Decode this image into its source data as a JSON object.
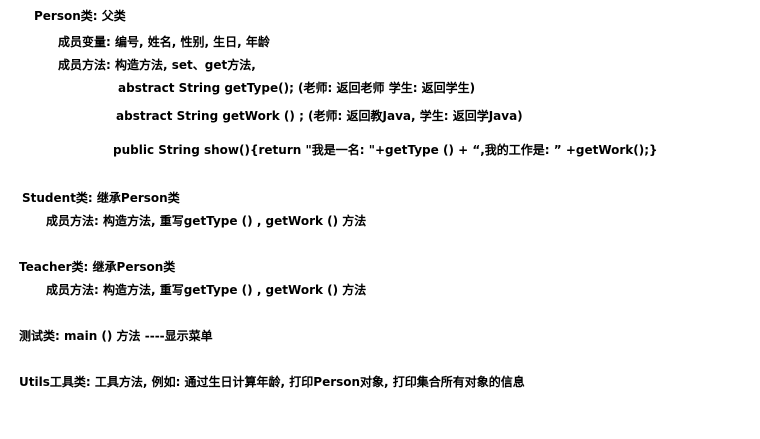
{
  "document": {
    "person": {
      "heading": "Person类: 父类",
      "fields": "成员变量: 编号, 姓名, 性别, 生日, 年龄",
      "methods": "成员方法:  构造方法, set、get方法,",
      "get_type": "abstract String getType(); (老师:  返回老师  学生:  返回学生)",
      "get_work": "abstract  String getWork  ()  ;   (老师:  返回教Java, 学生: 返回学Java)",
      "show": "public String show(){return \"我是一名: \"+getType  ()  + “,我的工作是: ”  +getWork();}"
    },
    "student": {
      "heading": "Student类:  继承Person类",
      "methods": "成员方法:  构造方法, 重写getType  ()  ,  getWork  ()  方法"
    },
    "teacher": {
      "heading": "Teacher类:  继承Person类",
      "methods": "成员方法:  构造方法, 重写getType  ()  ,  getWork  ()  方法"
    },
    "test": {
      "heading": "测试类:   main  ()  方法 ----显示菜单"
    },
    "utils": {
      "heading": "Utils工具类: 工具方法, 例如:  通过生日计算年龄, 打印Person对象, 打印集合所有对象的信息"
    }
  }
}
